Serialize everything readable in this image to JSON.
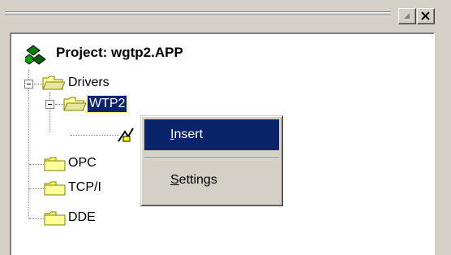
{
  "window": {
    "minimize_icon": "minimize-icon",
    "close_icon": "close-icon"
  },
  "tree": {
    "project": {
      "label": "Project: wgtp2.APP",
      "icon": "project-icon"
    },
    "nodes": [
      {
        "label": "Drivers",
        "icon": "folder-open-icon",
        "expanded": true
      },
      {
        "label": "WTP2",
        "icon": "folder-open-icon",
        "expanded": true,
        "selected": true
      },
      {
        "label": "OPC",
        "icon": "folder-icon"
      },
      {
        "label": "TCP/I",
        "icon": "folder-icon"
      },
      {
        "label": "DDE",
        "icon": "folder-icon"
      }
    ]
  },
  "context_menu": {
    "items": [
      {
        "label": "Insert",
        "mnemonic": "I",
        "rest": "nsert",
        "active": true
      },
      {
        "label": "Settings",
        "mnemonic": "S",
        "rest": "ettings",
        "active": false
      }
    ]
  },
  "colors": {
    "face": "#d4d0c8",
    "highlight": "#0a246a",
    "folder_yellow": "#ffff99",
    "folder_dark": "#808000"
  }
}
